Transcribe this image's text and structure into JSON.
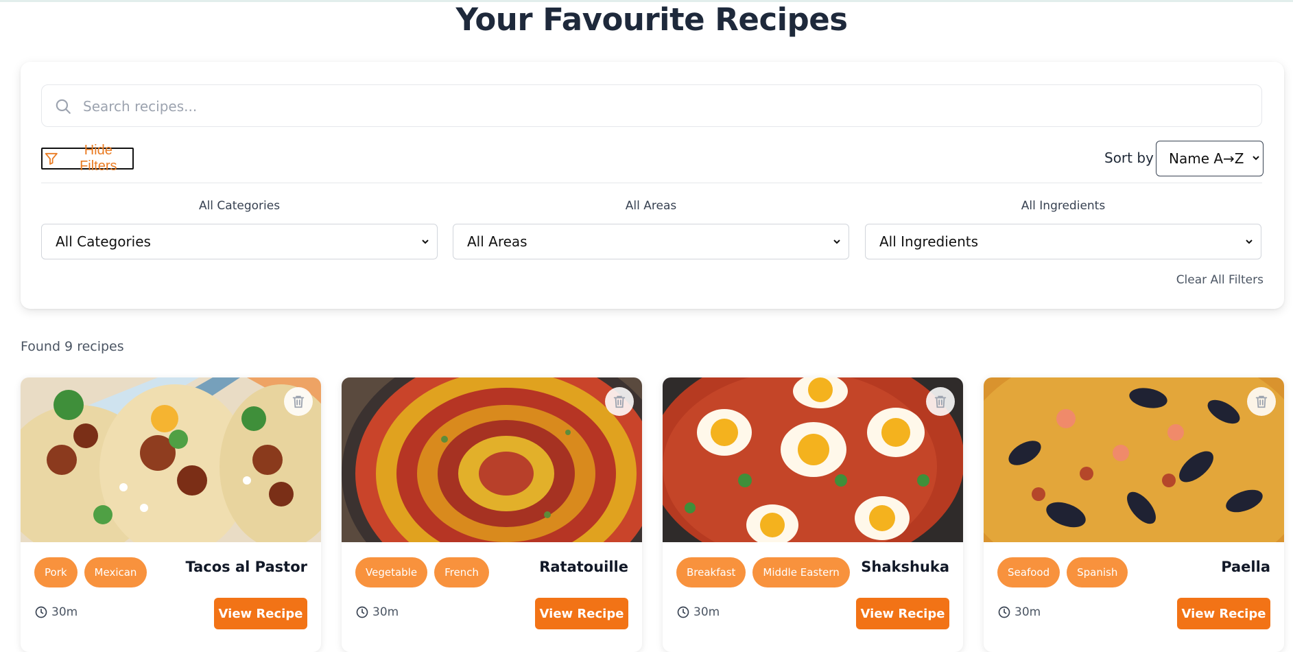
{
  "page": {
    "title": "Your Favourite Recipes"
  },
  "search": {
    "placeholder": "Search recipes..."
  },
  "filters": {
    "toggle_label": "Hide Filters",
    "sort_label": "Sort by",
    "sort_selected": "Name A→Z",
    "categories": {
      "label": "All Categories",
      "selected": "All Categories"
    },
    "areas": {
      "label": "All Areas",
      "selected": "All Areas"
    },
    "ingredients": {
      "label": "All Ingredients",
      "selected": "All Ingredients"
    },
    "clear_label": "Clear All Filters"
  },
  "results": {
    "found_text": "Found 9 recipes"
  },
  "recipes": [
    {
      "title": "Tacos al Pastor",
      "tags": [
        "Pork",
        "Mexican"
      ],
      "time": "30m",
      "button": "View Recipe"
    },
    {
      "title": "Ratatouille",
      "tags": [
        "Vegetable",
        "French"
      ],
      "time": "30m",
      "button": "View Recipe"
    },
    {
      "title": "Shakshuka",
      "tags": [
        "Breakfast",
        "Middle Eastern"
      ],
      "time": "30m",
      "button": "View Recipe"
    },
    {
      "title": "Paella",
      "tags": [
        "Seafood",
        "Spanish"
      ],
      "time": "30m",
      "button": "View Recipe"
    }
  ],
  "colors": {
    "accent": "#f27316",
    "tag": "#f8923d",
    "heading": "#1e293b"
  },
  "icons": {
    "search": "search-icon",
    "filter": "filter-icon",
    "delete": "trash-icon",
    "time": "clock-icon"
  }
}
